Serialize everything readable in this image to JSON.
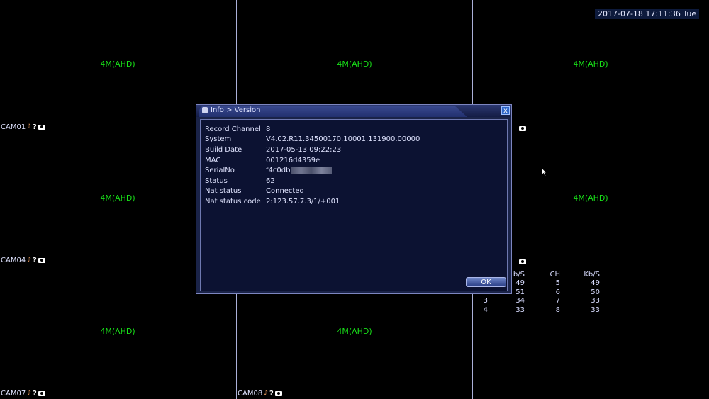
{
  "datetime": "2017-07-18 17:11:36 Tue",
  "cells": [
    {
      "resolution": "4M(AHD)",
      "label": "CAM01"
    },
    {
      "resolution": "4M(AHD)",
      "label": ""
    },
    {
      "resolution": "4M(AHD)",
      "label": ""
    },
    {
      "resolution": "4M(AHD)",
      "label": "CAM04"
    },
    {
      "resolution": "",
      "label": ""
    },
    {
      "resolution": "4M(AHD)",
      "label": ""
    },
    {
      "resolution": "4M(AHD)",
      "label": "CAM07"
    },
    {
      "resolution": "4M(AHD)",
      "label": "CAM08"
    }
  ],
  "stats": {
    "headers": [
      "",
      "b/S",
      "CH",
      "Kb/S"
    ],
    "rows": [
      [
        "",
        "49",
        "5",
        "49"
      ],
      [
        "",
        "51",
        "6",
        "50"
      ],
      [
        "3",
        "34",
        "7",
        "33"
      ],
      [
        "4",
        "33",
        "8",
        "33"
      ]
    ]
  },
  "dialog": {
    "title": "Info > Version",
    "close_label": "x",
    "ok_label": "OK",
    "fields": [
      {
        "label": "Record Channel",
        "value": "8"
      },
      {
        "label": "System",
        "value": "V4.02.R11.34500170.10001.131900.00000"
      },
      {
        "label": "Build Date",
        "value": "2017-05-13 09:22:23"
      },
      {
        "label": "MAC",
        "value": "001216d4359e"
      },
      {
        "label": "SerialNo",
        "value": "f4c0db"
      },
      {
        "label": "Status",
        "value": "62"
      },
      {
        "label": "Nat status",
        "value": "Connected"
      },
      {
        "label": "Nat status code",
        "value": "2:123.57.7.3/1/+001"
      }
    ]
  },
  "icons": [
    "audio-muted-icon",
    "help-icon",
    "record-icon",
    "window-icon",
    "close-icon",
    "mouse-cursor-icon"
  ],
  "colors": {
    "resolution_text": "#18e018",
    "grid_line": "#aab0d8",
    "dialog_bg": "#0c1232"
  }
}
